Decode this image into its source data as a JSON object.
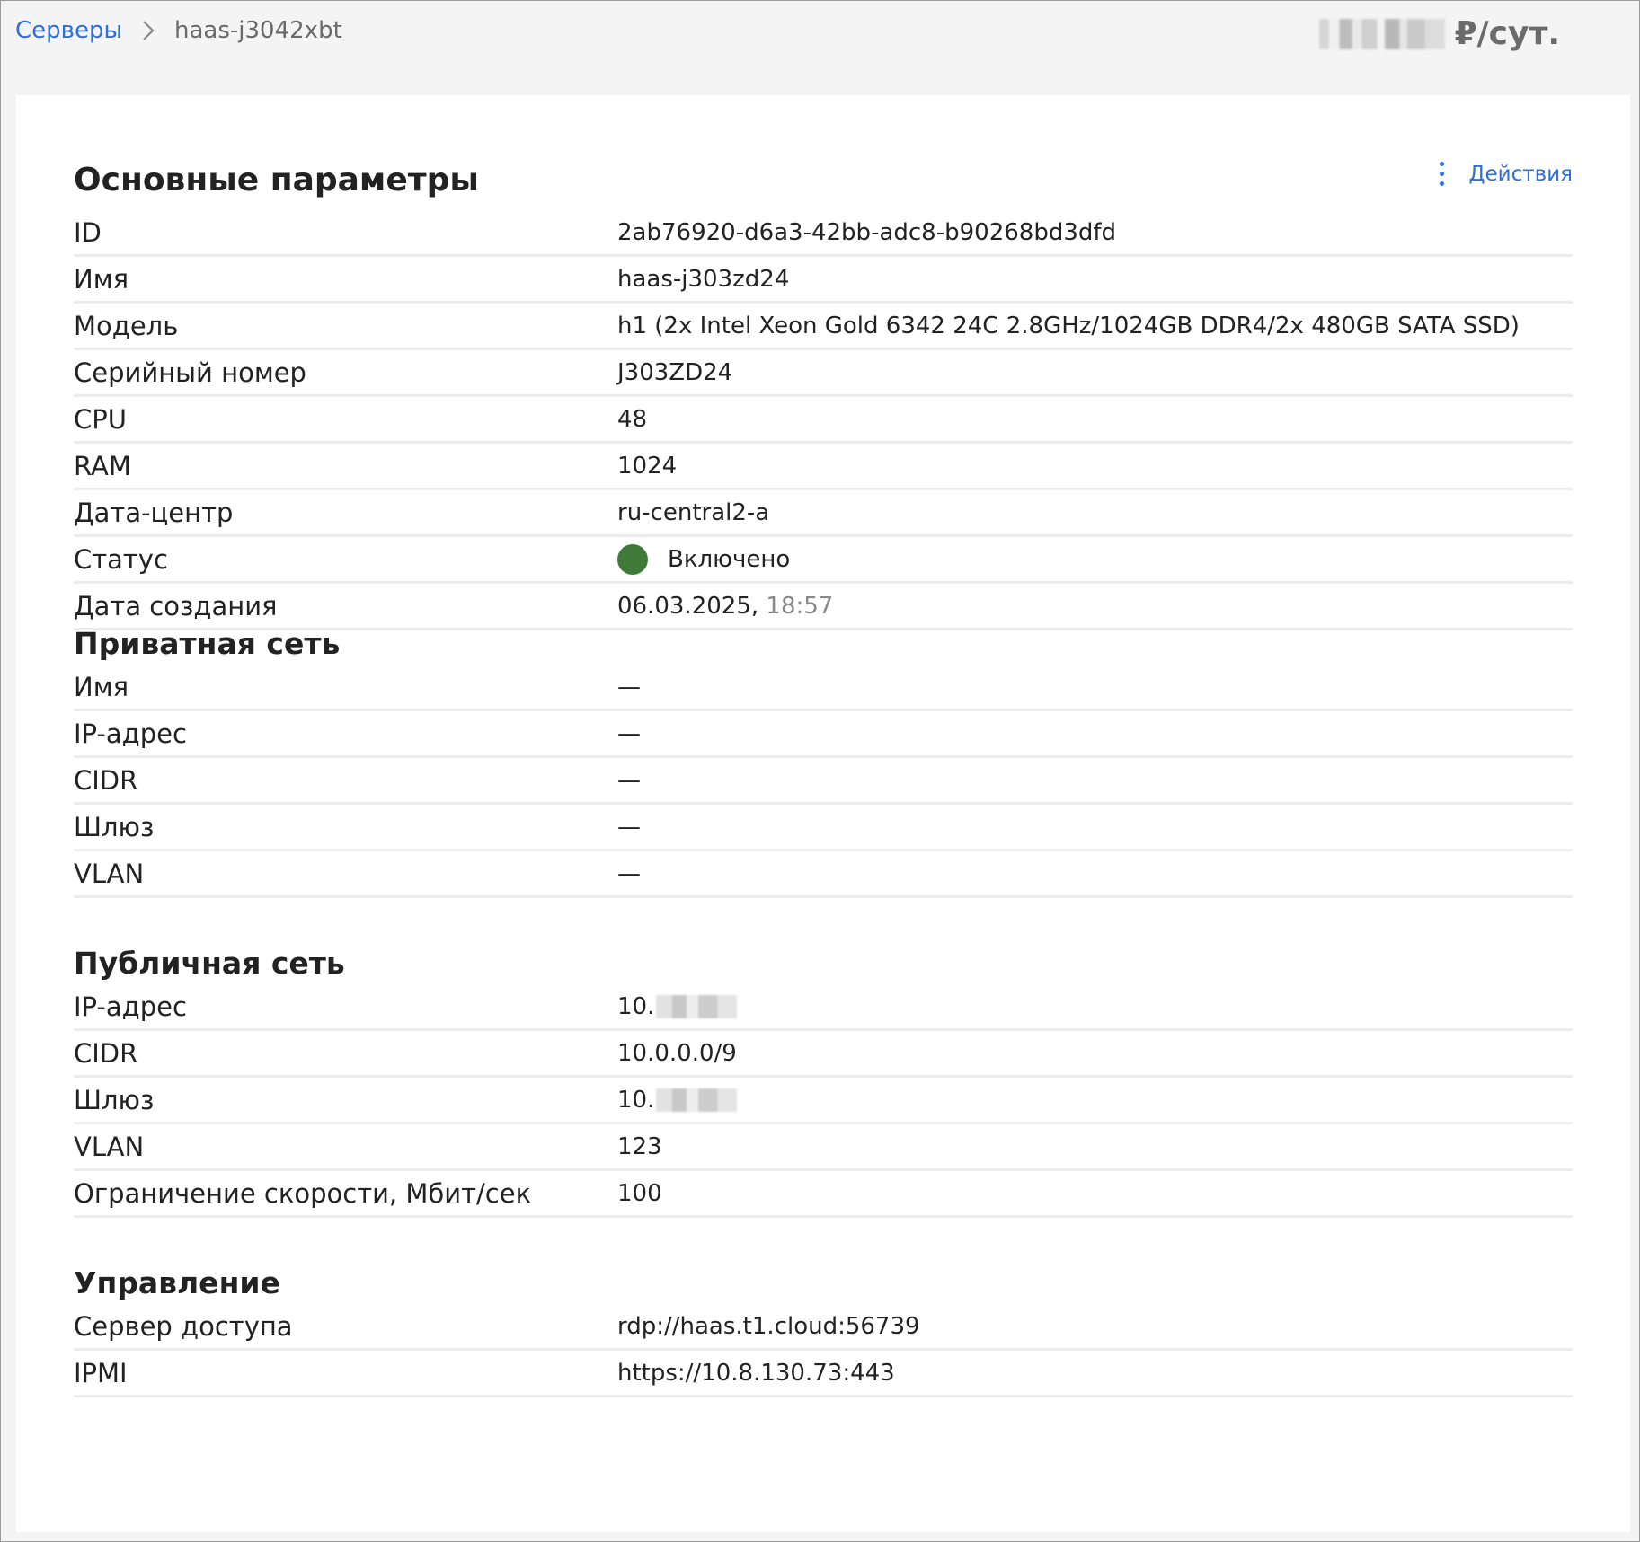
{
  "breadcrumb": {
    "root": "Серверы",
    "current": "haas-j3042xbt"
  },
  "price": {
    "suffix": "₽/сут."
  },
  "card": {
    "title": "Основные параметры",
    "actions_label": "Действия"
  },
  "main_params": [
    {
      "label": "ID",
      "value": "2ab76920-d6a3-42bb-adc8-b90268bd3dfd"
    },
    {
      "label": "Имя",
      "value": "haas-j303zd24"
    },
    {
      "label": "Модель",
      "value": "h1 (2x Intel Xeon Gold 6342 24C 2.8GHz/1024GB DDR4/2x 480GB SATA SSD)"
    },
    {
      "label": "Серийный номер",
      "value": "J303ZD24"
    },
    {
      "label": "CPU",
      "value": "48"
    },
    {
      "label": "RAM",
      "value": "1024"
    },
    {
      "label": "Дата-центр",
      "value": "ru-central2-a"
    },
    {
      "label": "Статус",
      "value": "Включено"
    },
    {
      "label": "Дата создания",
      "value": "06.03.2025,",
      "time": "18:57"
    }
  ],
  "status_color": "#3f7a3a",
  "private_network": {
    "title": "Приватная сеть",
    "rows": [
      {
        "label": "Имя",
        "value": "—"
      },
      {
        "label": "IP-адрес",
        "value": "—"
      },
      {
        "label": "CIDR",
        "value": "—"
      },
      {
        "label": "Шлюз",
        "value": "—"
      },
      {
        "label": "VLAN",
        "value": "—"
      }
    ]
  },
  "public_network": {
    "title": "Публичная сеть",
    "rows": [
      {
        "label": "IP-адрес",
        "value": "10."
      },
      {
        "label": "CIDR",
        "value": "10.0.0.0/9"
      },
      {
        "label": "Шлюз",
        "value": "10."
      },
      {
        "label": "VLAN",
        "value": "123"
      },
      {
        "label": "Ограничение скорости, Мбит/сек",
        "value": "100"
      }
    ]
  },
  "management": {
    "title": "Управление",
    "rows": [
      {
        "label": "Сервер доступа",
        "value": "rdp://haas.t1.cloud:56739"
      },
      {
        "label": "IPMI",
        "value": "https://10.8.130.73:443"
      }
    ]
  }
}
